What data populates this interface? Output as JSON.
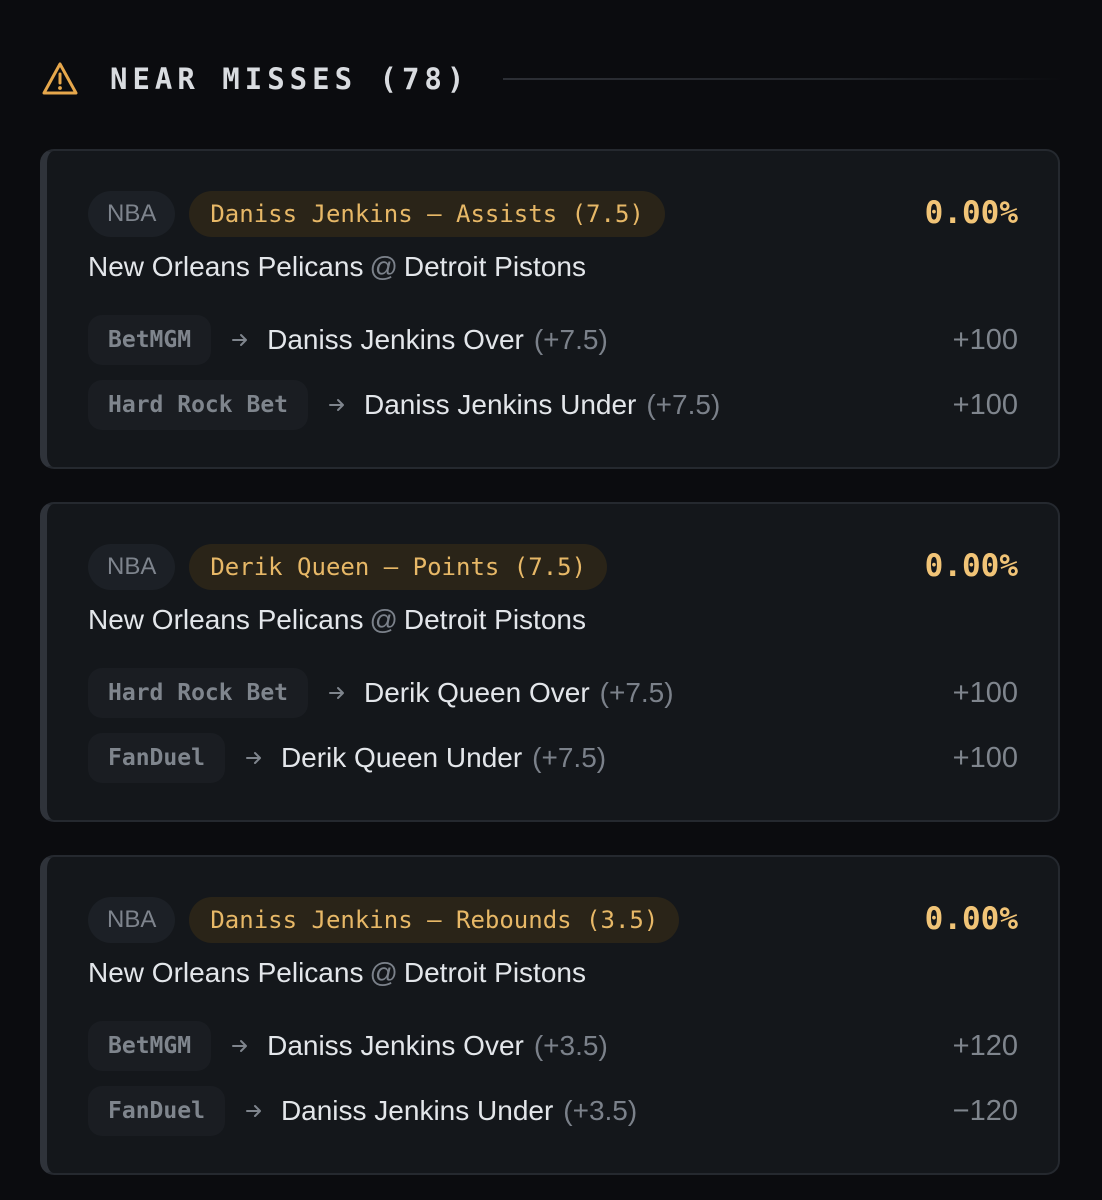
{
  "header": {
    "icon": "warning-triangle-icon",
    "title": "NEAR MISSES (78)"
  },
  "colors": {
    "background": "#0b0c0f",
    "card": "#14171b",
    "accent": "#f1c477",
    "market_pill_bg": "#2a2418",
    "muted": "#7f858d"
  },
  "cards": [
    {
      "league": "NBA",
      "market": "Daniss Jenkins — Assists (7.5)",
      "percentage": "0.00%",
      "away_team": "New Orleans Pelicans",
      "at": "@",
      "home_team": "Detroit Pistons",
      "legs": [
        {
          "book": "BetMGM",
          "selection": "Daniss Jenkins Over",
          "line": "(+7.5)",
          "odds": "+100"
        },
        {
          "book": "Hard Rock Bet",
          "selection": "Daniss Jenkins Under",
          "line": "(+7.5)",
          "odds": "+100"
        }
      ]
    },
    {
      "league": "NBA",
      "market": "Derik Queen — Points (7.5)",
      "percentage": "0.00%",
      "away_team": "New Orleans Pelicans",
      "at": "@",
      "home_team": "Detroit Pistons",
      "legs": [
        {
          "book": "Hard Rock Bet",
          "selection": "Derik Queen Over",
          "line": "(+7.5)",
          "odds": "+100"
        },
        {
          "book": "FanDuel",
          "selection": "Derik Queen Under",
          "line": "(+7.5)",
          "odds": "+100"
        }
      ]
    },
    {
      "league": "NBA",
      "market": "Daniss Jenkins — Rebounds (3.5)",
      "percentage": "0.00%",
      "away_team": "New Orleans Pelicans",
      "at": "@",
      "home_team": "Detroit Pistons",
      "legs": [
        {
          "book": "BetMGM",
          "selection": "Daniss Jenkins Over",
          "line": "(+3.5)",
          "odds": "+120"
        },
        {
          "book": "FanDuel",
          "selection": "Daniss Jenkins Under",
          "line": "(+3.5)",
          "odds": "−120"
        }
      ]
    }
  ]
}
